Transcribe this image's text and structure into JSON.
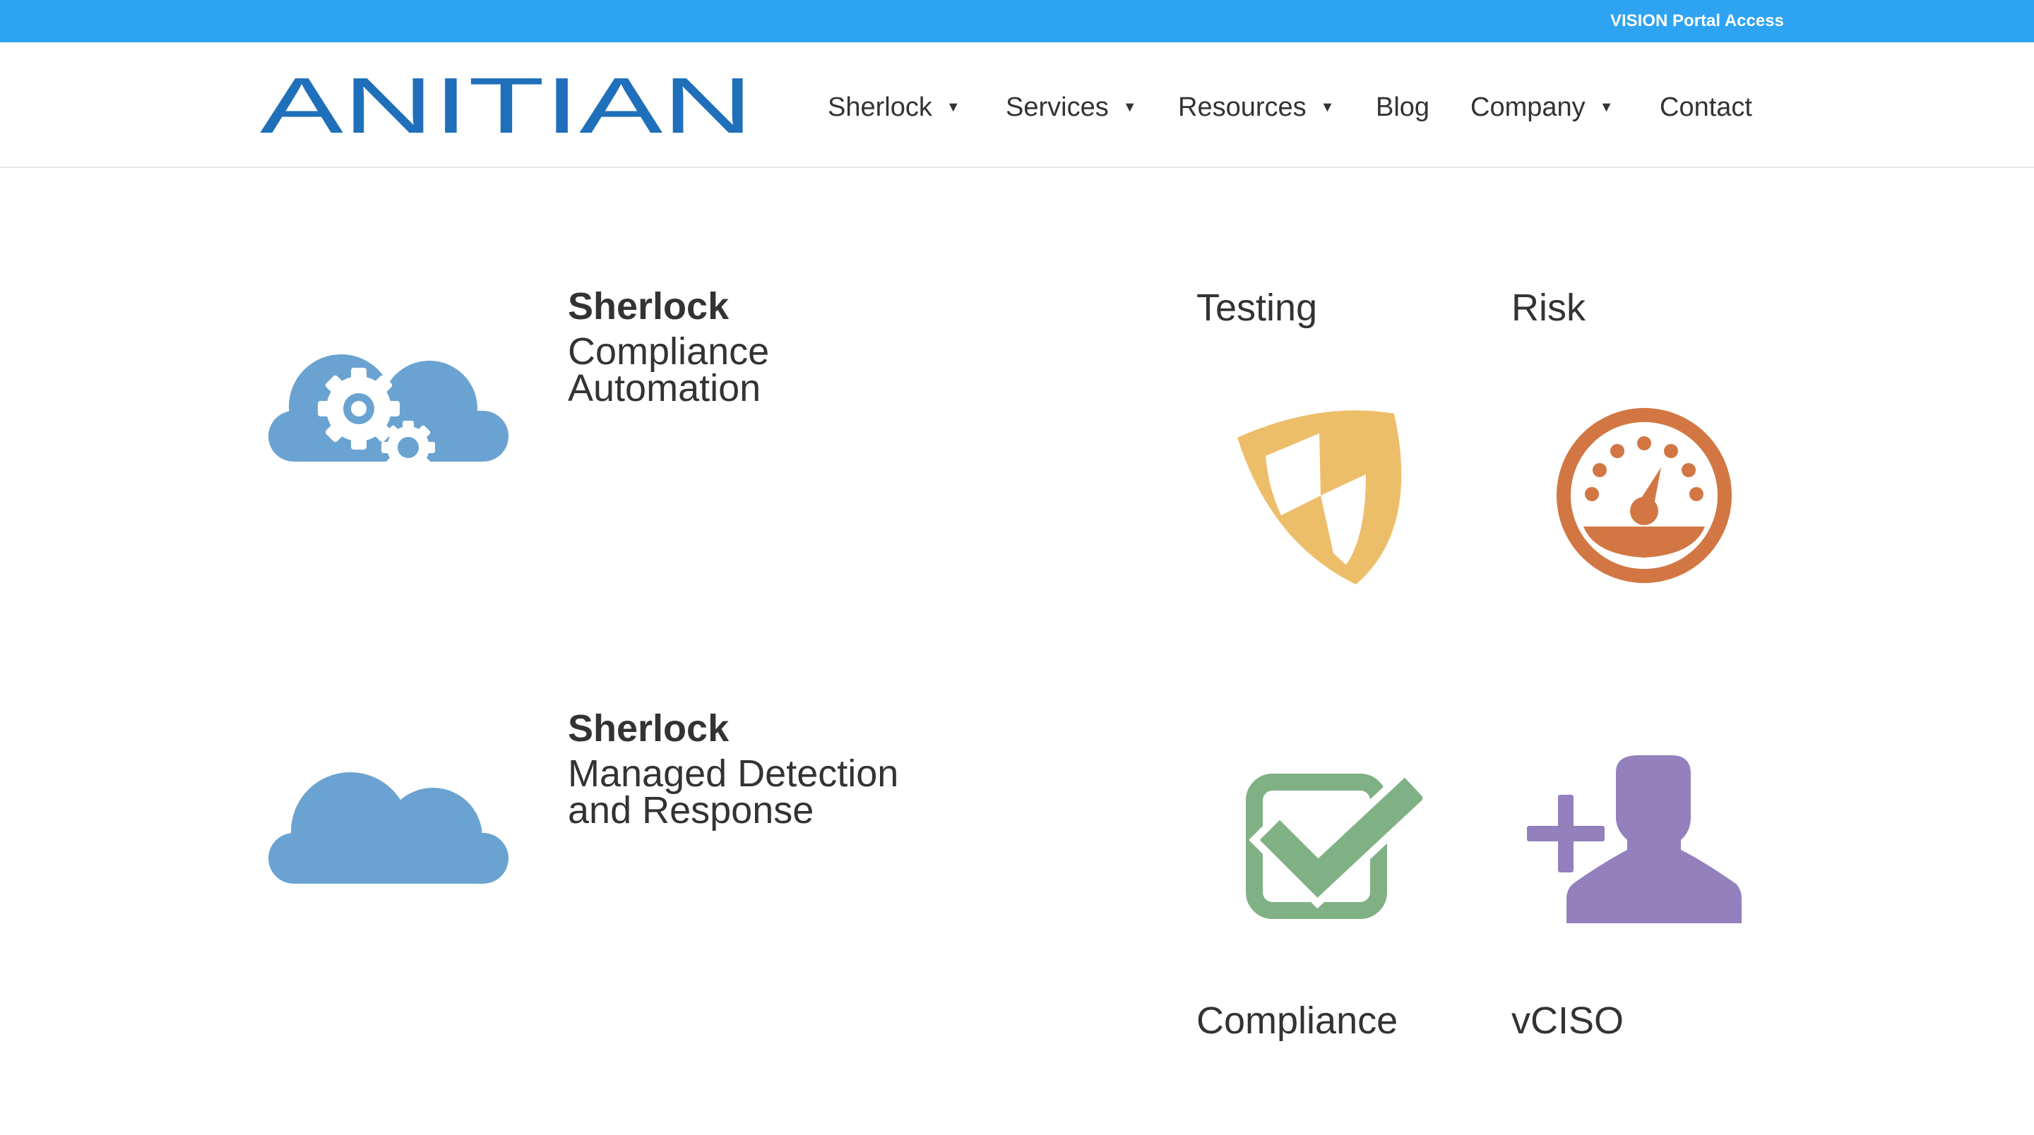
{
  "topbar": {
    "portal_link": "VISION Portal Access"
  },
  "brand": {
    "logo_text": "ANITIAN",
    "logo_color": "#1f6fba"
  },
  "nav": {
    "items": [
      {
        "label": "Sherlock",
        "has_dropdown": true
      },
      {
        "label": "Services",
        "has_dropdown": true
      },
      {
        "label": "Resources",
        "has_dropdown": true
      },
      {
        "label": "Blog",
        "has_dropdown": false
      },
      {
        "label": "Company",
        "has_dropdown": true
      },
      {
        "label": "Contact",
        "has_dropdown": false
      }
    ],
    "caret": "▼"
  },
  "products": [
    {
      "name": "Sherlock",
      "description": "Compliance Automation",
      "icon": "cloud-gear-icon",
      "color": "#6aa3d1"
    },
    {
      "name": "Sherlock",
      "description": "Managed Detection and Response",
      "icon": "cloud-icon",
      "color": "#6aa3d1"
    }
  ],
  "services": [
    {
      "label": "Testing",
      "icon": "shield-icon",
      "color": "#edbe6a"
    },
    {
      "label": "Risk",
      "icon": "speedometer-icon",
      "color": "#d27743"
    },
    {
      "label": "Compliance",
      "icon": "checkbox-check-icon",
      "color": "#80b184"
    },
    {
      "label": "vCISO",
      "icon": "add-user-icon",
      "color": "#9380bc"
    }
  ]
}
